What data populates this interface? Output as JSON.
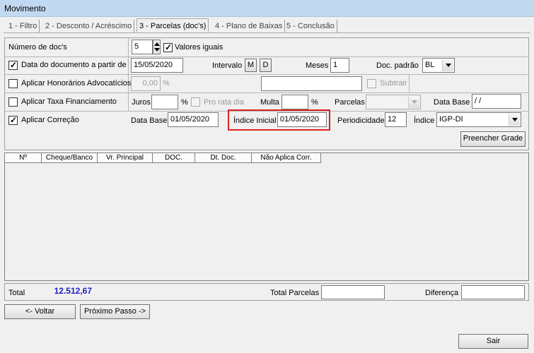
{
  "window": {
    "title": "Movimento"
  },
  "tabs": [
    {
      "label": "1 - Filtro"
    },
    {
      "label": "2 - Desconto / Acréscimo"
    },
    {
      "label": "3 - Parcelas (doc's)"
    },
    {
      "label": "4 - Plano de Baixas"
    },
    {
      "label": "5 - Conclusão"
    }
  ],
  "form": {
    "num_docs_label": "Número de doc's",
    "num_docs_value": "5",
    "valores_iguais_label": "Valores iguais",
    "data_doc_label": "Data do documento a partir de",
    "data_doc_value": "15/05/2020",
    "intervalo_label": "Intervalo",
    "intervalo_m": "M",
    "intervalo_d": "D",
    "meses_label": "Meses",
    "meses_value": "1",
    "doc_padrao_label": "Doc. padrão",
    "doc_padrao_value": "BL",
    "honorarios_label": "Aplicar Honorários Advocatícios",
    "honorarios_value": "0,00",
    "percent": "%",
    "subtrair_label": "Subtrair",
    "taxa_label": "Aplicar Taxa Financiamento",
    "juros_label": "Juros",
    "pro_rata_label": "Pro rata dia",
    "multa_label": "Multa",
    "parcelas_label": "Parcelas",
    "data_base_label": "Data Base",
    "data_base_taxa_value": " / /",
    "correcao_label": "Aplicar Correção",
    "data_base_correcao_value": "01/05/2020",
    "indice_inicial_label": "Índice Inicial",
    "indice_inicial_value": "01/05/2020",
    "periodicidade_label": "Periodicidade",
    "periodicidade_value": "12",
    "indice_label": "Índice",
    "indice_value": "IGP-DI",
    "preencher_grade": "Preencher Grade"
  },
  "grid": {
    "columns": [
      "Nº",
      "Cheque/Banco",
      "Vr. Principal",
      "DOC.",
      "Dt. Doc.",
      "Não Aplica Corr."
    ]
  },
  "totals": {
    "total_label": "Total",
    "total_value": "12.512,67",
    "total_parcelas_label": "Total Parcelas",
    "diferenca_label": "Diferença"
  },
  "nav": {
    "voltar": "<- Voltar",
    "proximo": "Próximo Passo ->",
    "sair": "Sair"
  },
  "colors": {
    "highlight": "#e02020",
    "total_value": "#1e1ec8"
  },
  "icons": [
    "spin-updown-icon",
    "checkmark-icon",
    "dropdown-arrow-icon"
  ]
}
